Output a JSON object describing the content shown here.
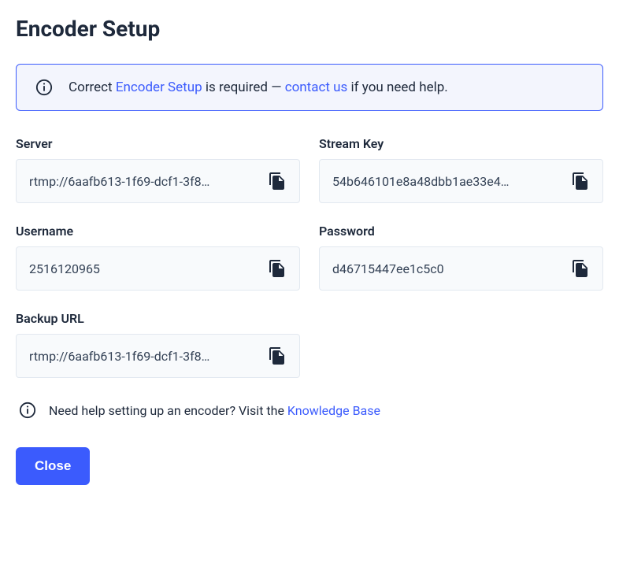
{
  "title": "Encoder Setup",
  "banner": {
    "prefix": "Correct ",
    "link1": "Encoder Setup",
    "mid": " is required — ",
    "link2": "contact us",
    "suffix": " if you need help."
  },
  "fields": {
    "server": {
      "label": "Server",
      "value": "rtmp://6aafb613-1f69-dcf1-3f8…"
    },
    "streamKey": {
      "label": "Stream Key",
      "value": "54b646101e8a48dbb1ae33e4…"
    },
    "username": {
      "label": "Username",
      "value": "2516120965"
    },
    "password": {
      "label": "Password",
      "value": "d46715447ee1c5c0"
    },
    "backupUrl": {
      "label": "Backup URL",
      "value": "rtmp://6aafb613-1f69-dcf1-3f8…"
    }
  },
  "help": {
    "text": "Need help setting up an encoder? Visit the ",
    "link": "Knowledge Base"
  },
  "closeLabel": "Close"
}
